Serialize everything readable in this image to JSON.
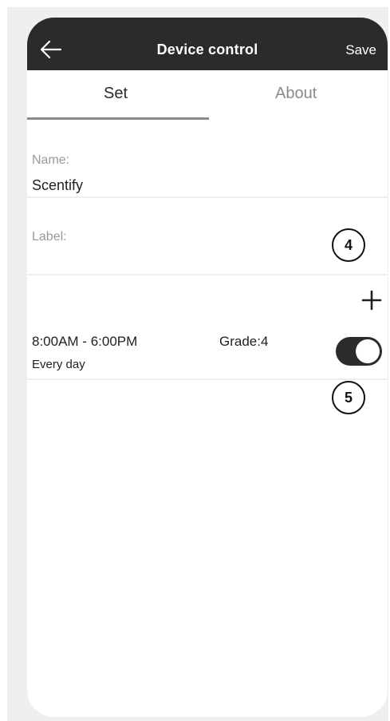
{
  "header": {
    "title": "Device control",
    "save_label": "Save",
    "back_icon": "arrow-left-icon"
  },
  "tabs": [
    {
      "label": "Set",
      "active": true
    },
    {
      "label": "About",
      "active": false
    }
  ],
  "fields": {
    "name_label": "Name:",
    "name_value": "Scentify",
    "label_label": "Label:",
    "label_value": ""
  },
  "schedule": {
    "time_range": "8:00AM - 6:00PM",
    "grade": "Grade:4",
    "repeat": "Every day",
    "enabled": true
  },
  "callouts": [
    "4",
    "5"
  ],
  "colors": {
    "header_bg": "#2b2b2b",
    "toggle_on": "#2b2b2b",
    "label_gray": "#9a9a9a"
  }
}
